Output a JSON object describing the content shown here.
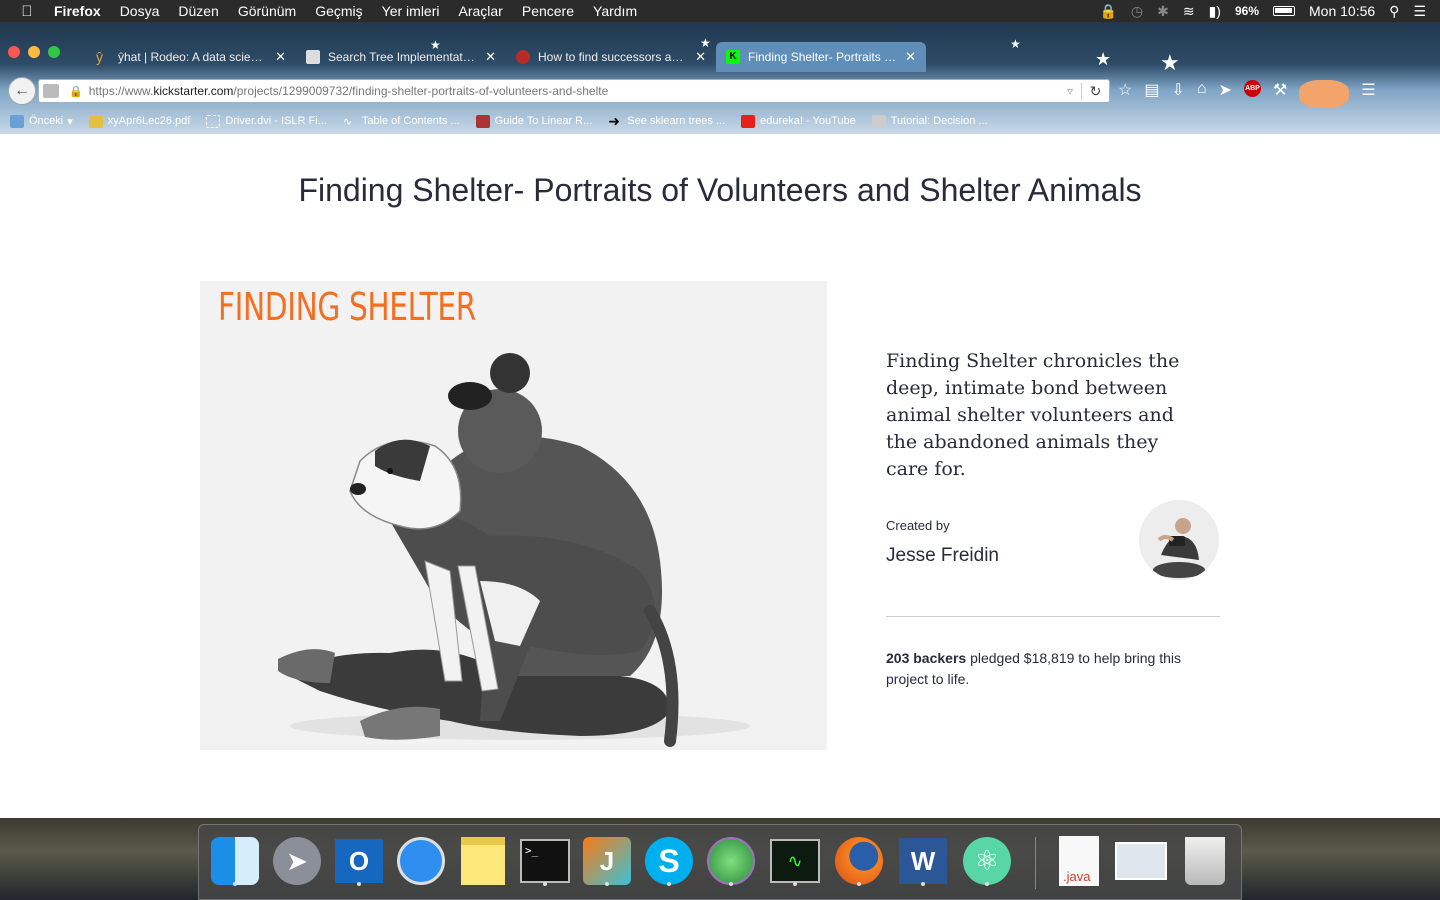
{
  "menubar": {
    "app": "Firefox",
    "items": [
      "Dosya",
      "Düzen",
      "Görünüm",
      "Geçmiş",
      "Yer imleri",
      "Araçlar",
      "Pencere",
      "Yardım"
    ],
    "battery": "96%",
    "clock": "Mon 10:56"
  },
  "tabs": [
    {
      "label": "ŷhat | Rodeo: A data scienc...",
      "active": false
    },
    {
      "label": "Search Tree Implementatio...",
      "active": false
    },
    {
      "label": "How to find successors and...",
      "active": false
    },
    {
      "label": "Finding Shelter- Portraits of ...",
      "active": true
    }
  ],
  "urlbar": {
    "prefix": "https://www.",
    "host": "kickstarter.com",
    "path": "/projects/1299009732/finding-shelter-portraits-of-volunteers-and-shelte"
  },
  "bookmarks": [
    {
      "label": "Önceki",
      "icon": "folder-icon"
    },
    {
      "label": "xyApr6Lec26.pdf",
      "icon": "pdf-icon"
    },
    {
      "label": "Driver.dvi - ISLR Fi...",
      "icon": "page-icon"
    },
    {
      "label": "Table of Contents ...",
      "icon": "pulse-icon"
    },
    {
      "label": "Guide To Linear R...",
      "icon": "image-icon"
    },
    {
      "label": "See sklearn trees ...",
      "icon": "arrow-icon"
    },
    {
      "label": "edureka! - YouTube",
      "icon": "youtube-icon"
    },
    {
      "label": "Tutorial: Decision ...",
      "icon": "doc-icon"
    }
  ],
  "project": {
    "title": "Finding Shelter- Portraits of Volunteers and Shelter Animals",
    "image_caption": "FINDING SHELTER",
    "blurb": "Finding Shelter chronicles the deep, intimate bond between animal shelter volunteers and the abandoned animals they care for.",
    "created_by_label": "Created by",
    "creator": "Jesse Freidin",
    "backers": "203 backers",
    "funding_text": " pledged $18,819 to help bring this project to life."
  },
  "dock": [
    "Finder",
    "Launchpad",
    "Outlook",
    "Safari",
    "Notes",
    "Terminal",
    "IntelliJ",
    "Skype",
    "Network",
    "Activity Monitor",
    "Firefox",
    "Word",
    "Atom",
    "Java file",
    "Screenshot",
    "Trash"
  ],
  "dock_java_label": ".java"
}
